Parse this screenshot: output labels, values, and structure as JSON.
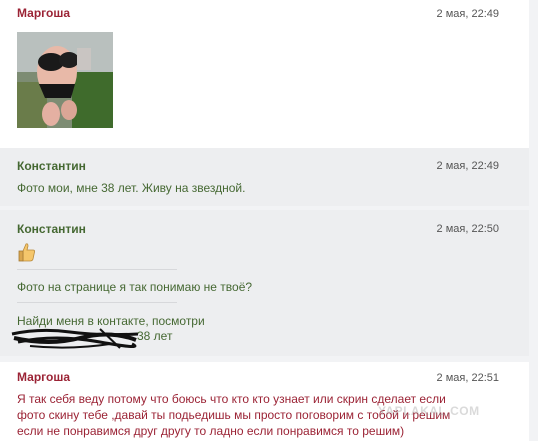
{
  "messages": [
    {
      "author": "Маргоша",
      "time": "2 мая, 22:49"
    },
    {
      "author": "Константин",
      "time": "2 мая, 22:49",
      "text": "Фото мои, мне 38 лет. Живу на звездной."
    },
    {
      "author": "Константин",
      "time": "2 мая, 22:50",
      "line1": "Фото на странице я так понимаю не твоё?",
      "line2": "Найди меня в контакте, посмотри",
      "line3": "38 лет"
    },
    {
      "author": "Маргоша",
      "time": "2 мая, 22:51",
      "lines": [
        "Я так себя веду потому что боюсь что кто кто узнает или скрин сделает если",
        "фото скину тебе ,давай ты подьедишь мы просто поговорим с тобой и решим",
        "если не понравимся друг другу то ладно если понравимся то решим)"
      ]
    }
  ],
  "watermark": "YAPLAKAL.COM",
  "icons": {
    "thumb": "thumbs-up-icon"
  }
}
